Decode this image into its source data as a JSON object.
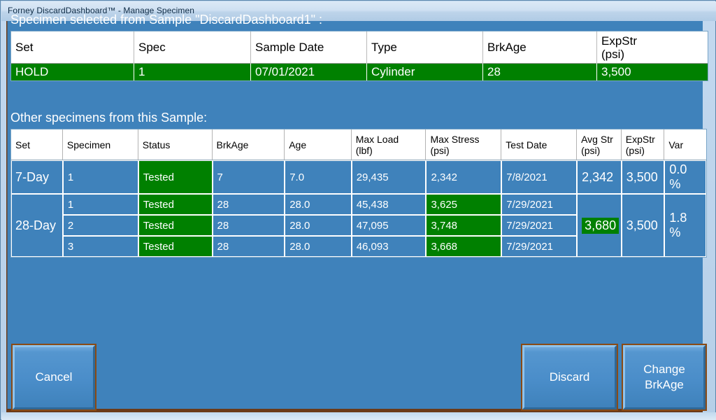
{
  "window": {
    "title": "Forney DiscardDashboard™ - Manage Specimen"
  },
  "headings": {
    "selected": "Specimen selected from Sample \"DiscardDashboard1\" :",
    "others": "Other specimens from this Sample:"
  },
  "colors": {
    "panel_blue": "#3f82bb",
    "status_green": "#008000",
    "titlebar_blue": "#cfe0f2",
    "button_border_orange": "#8a4a14"
  },
  "selected_table": {
    "columns": [
      "Set",
      "Spec",
      "Sample Date",
      "Type",
      "BrkAge",
      "ExpStr\n(psi)"
    ],
    "row": {
      "set": "HOLD",
      "spec": "1",
      "sample_date": "07/01/2021",
      "type": "Cylinder",
      "brkage": "28",
      "expstr": "3,500"
    }
  },
  "others_table": {
    "columns": [
      "Set",
      "Specimen",
      "Status",
      "BrkAge",
      "Age",
      "Max Load\n(lbf)",
      "Max Stress\n(psi)",
      "Test Date",
      "Avg Str\n(psi)",
      "ExpStr\n(psi)",
      "Var"
    ],
    "groups": [
      {
        "set": "7-Day",
        "avg_str": "2,342",
        "avg_str_highlighted": false,
        "exp_str": "3,500",
        "var": "0.0 %",
        "rows": [
          {
            "specimen": "1",
            "status": "Tested",
            "brkage": "7",
            "age": "7.0",
            "max_load": "29,435",
            "max_stress": "2,342",
            "max_stress_highlighted": false,
            "test_date": "7/8/2021"
          }
        ]
      },
      {
        "set": "28-Day",
        "avg_str": "3,680",
        "avg_str_highlighted": true,
        "exp_str": "3,500",
        "var": "1.8 %",
        "rows": [
          {
            "specimen": "1",
            "status": "Tested",
            "brkage": "28",
            "age": "28.0",
            "max_load": "45,438",
            "max_stress": "3,625",
            "max_stress_highlighted": true,
            "test_date": "7/29/2021"
          },
          {
            "specimen": "2",
            "status": "Tested",
            "brkage": "28",
            "age": "28.0",
            "max_load": "47,095",
            "max_stress": "3,748",
            "max_stress_highlighted": true,
            "test_date": "7/29/2021"
          },
          {
            "specimen": "3",
            "status": "Tested",
            "brkage": "28",
            "age": "28.0",
            "max_load": "46,093",
            "max_stress": "3,668",
            "max_stress_highlighted": true,
            "test_date": "7/29/2021"
          }
        ]
      }
    ]
  },
  "buttons": {
    "cancel": "Cancel",
    "discard": "Discard",
    "change_brkage": "Change\nBrkAge"
  }
}
